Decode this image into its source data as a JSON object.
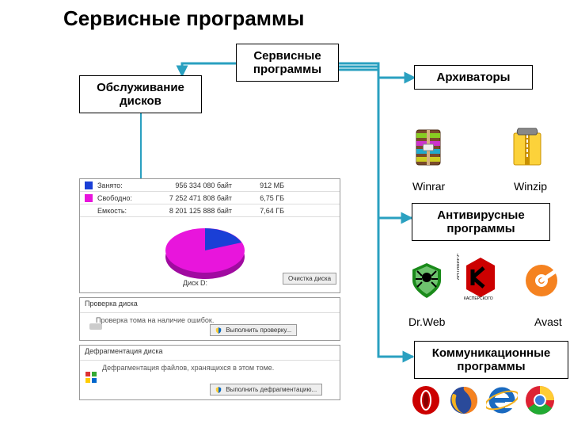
{
  "title": "Сервисные программы",
  "boxes": {
    "serv_prog": "Сервисные программы",
    "obsl": "Обслуживание дисков",
    "arch": "Архиваторы",
    "antiv": "Антивирусные программы",
    "comm": "Коммуникационные программы"
  },
  "labels": {
    "winrar": "Winrar",
    "winzip": "Winzip",
    "drweb": "Dr.Web",
    "avast": "Avast"
  },
  "disk_usage": {
    "used_label": "Занято:",
    "used_bytes": "956 334 080 байт",
    "used_mb": "912 МБ",
    "free_label": "Свободно:",
    "free_bytes": "7 252 471 808 байт",
    "free_gb": "6,75 ГБ",
    "total_label": "Емкость:",
    "total_bytes": "8 201 125 888 байт",
    "total_gb": "7,64 ГБ",
    "disk_name": "Диск D:",
    "clean_btn": "Очистка диска"
  },
  "check_disk": {
    "title": "Проверка диска",
    "line": "Проверка тома на наличие ошибок.",
    "btn": "Выполнить проверку..."
  },
  "defrag": {
    "title": "Дефрагментация диска",
    "line": "Дефрагментация файлов, хранящихся в этом томе.",
    "btn": "Выполнить дефрагментацию..."
  },
  "icons": {
    "winrar": "winrar-icon",
    "winzip": "winzip-icon",
    "drweb": "drweb-icon",
    "kaspersky": "kaspersky-icon",
    "avast": "avast-icon",
    "opera": "opera-icon",
    "firefox": "firefox-icon",
    "ie": "ie-icon",
    "chrome": "chrome-icon"
  },
  "chart_data": {
    "type": "pie",
    "title": "Диск D:",
    "categories": [
      "Занято",
      "Свободно"
    ],
    "values": [
      912,
      6912
    ],
    "unit": "МБ",
    "colors": [
      "#1a3fd6",
      "#e815dc"
    ]
  }
}
